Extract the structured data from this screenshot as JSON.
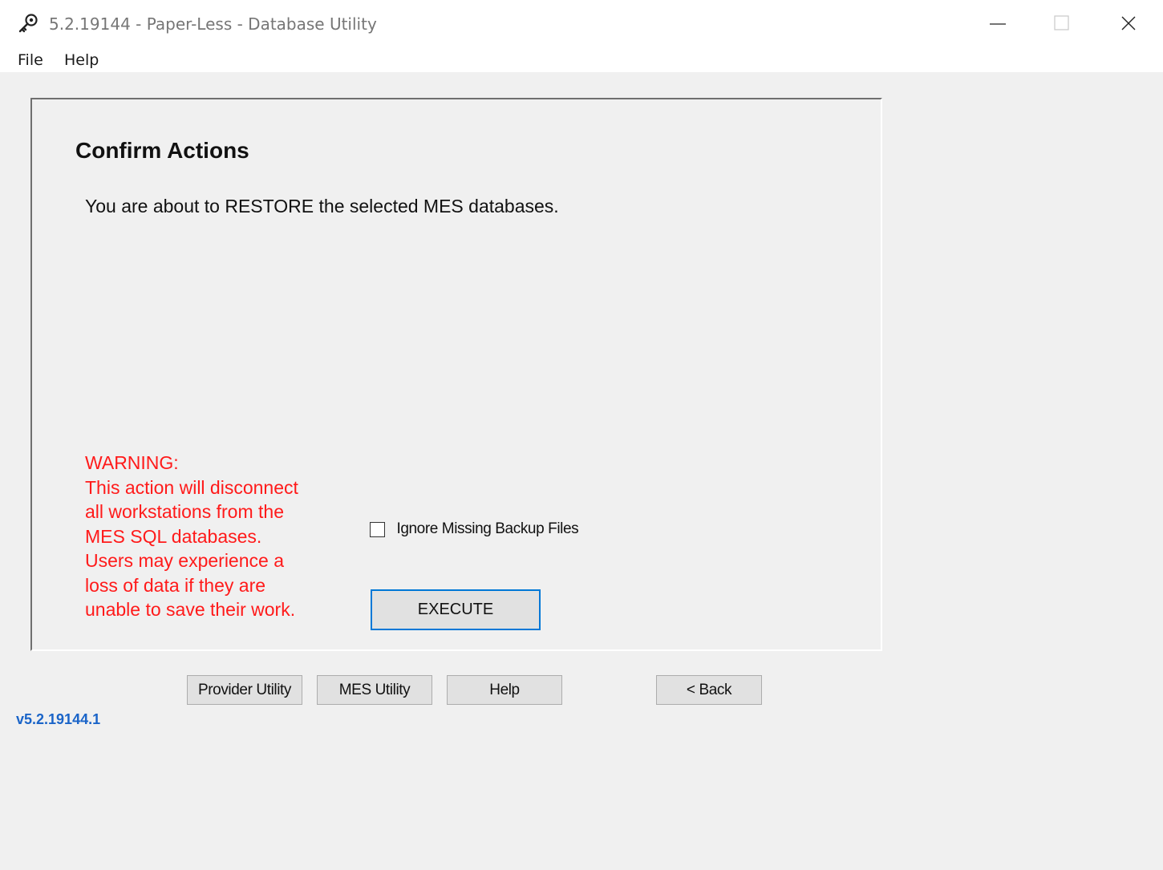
{
  "window": {
    "title": "5.2.19144 - Paper-Less - Database Utility",
    "app_icon": "key-wrench-icon",
    "controls": [
      "minimize-icon",
      "maximize-icon",
      "close-icon"
    ]
  },
  "menubar": {
    "items": [
      {
        "label": "File"
      },
      {
        "label": "Help"
      }
    ]
  },
  "confirm": {
    "title": "Confirm Actions",
    "message": "You are about to RESTORE the selected MES databases.",
    "warning_lines": [
      "WARNING:",
      "This action will disconnect",
      "all workstations from the",
      "MES SQL databases.",
      "Users may experience a",
      "loss of data if they are",
      "unable to save their work."
    ],
    "ignore_missing": {
      "label": "Ignore Missing Backup Files",
      "checked": false
    },
    "execute_label": "EXECUTE"
  },
  "nav": {
    "provider_utility": "Provider Utility",
    "mes_utility": "MES Utility",
    "help": "Help",
    "back": "< Back"
  },
  "version": "v5.2.19144.1",
  "colors": {
    "warning": "#ff1a1a",
    "version": "#1a64c8",
    "focus_border": "#0078d7",
    "background": "#f0f0f0"
  }
}
